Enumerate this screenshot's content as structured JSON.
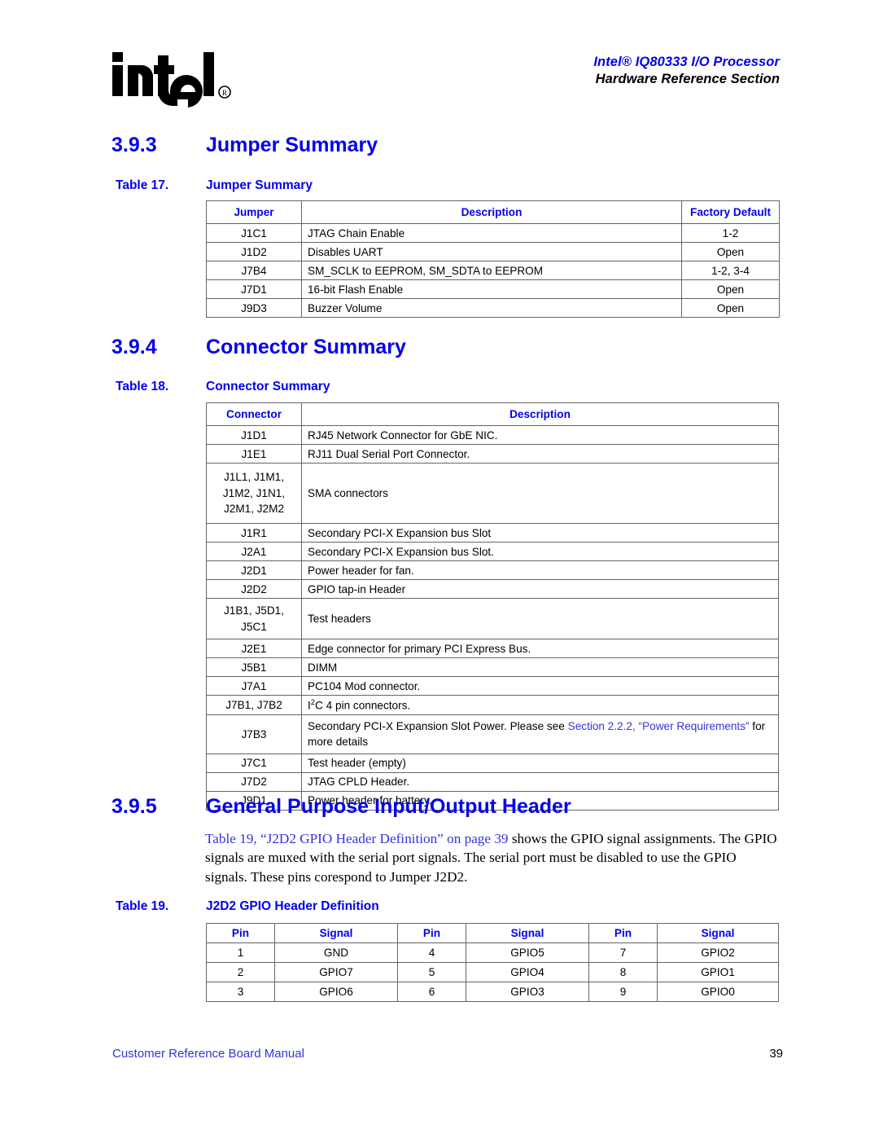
{
  "header": {
    "logo_alt": "intel",
    "title_line1": "Intel® IQ80333 I/O Processor",
    "title_line2": "Hardware Reference Section"
  },
  "sections": {
    "jumper": {
      "number": "3.9.3",
      "title": "Jumper Summary"
    },
    "connector": {
      "number": "3.9.4",
      "title": "Connector Summary"
    },
    "gpio": {
      "number": "3.9.5",
      "title": "General Purpose Input/Output Header"
    }
  },
  "table17": {
    "caption_number": "Table 17.",
    "caption_title": "Jumper Summary",
    "columns": [
      "Jumper",
      "Description",
      "Factory Default"
    ],
    "rows": [
      {
        "jumper": "J1C1",
        "description": "JTAG Chain Enable",
        "factory_default": "1-2"
      },
      {
        "jumper": "J1D2",
        "description": "Disables UART",
        "factory_default": "Open"
      },
      {
        "jumper": "J7B4",
        "description": "SM_SCLK to EEPROM, SM_SDTA to EEPROM",
        "factory_default": "1-2, 3-4"
      },
      {
        "jumper": "J7D1",
        "description": "16-bit Flash Enable",
        "factory_default": "Open"
      },
      {
        "jumper": "J9D3",
        "description": "Buzzer Volume",
        "factory_default": "Open"
      }
    ]
  },
  "table18": {
    "caption_number": "Table 18.",
    "caption_title": "Connector Summary",
    "columns": [
      "Connector",
      "Description"
    ],
    "rows": [
      {
        "connector": "J1D1",
        "description": "RJ45 Network Connector for GbE NIC."
      },
      {
        "connector": "J1E1",
        "description": "RJ11 Dual Serial Port Connector."
      },
      {
        "connector": "J1L1, J1M1,\nJ1M2, J1N1,\nJ2M1, J2M2",
        "description": "SMA connectors"
      },
      {
        "connector": "J1R1",
        "description": "Secondary PCI-X Expansion bus Slot"
      },
      {
        "connector": "J2A1",
        "description": "Secondary PCI-X Expansion bus Slot."
      },
      {
        "connector": "J2D1",
        "description": "Power header for fan."
      },
      {
        "connector": "J2D2",
        "description": "GPIO tap-in Header"
      },
      {
        "connector": "J1B1, J5D1,\nJ5C1",
        "description": "Test headers"
      },
      {
        "connector": "J2E1",
        "description": "Edge connector for primary PCI Express Bus."
      },
      {
        "connector": "J5B1",
        "description": "DIMM"
      },
      {
        "connector": "J7A1",
        "description": "PC104 Mod connector."
      },
      {
        "connector": "J7B1, J7B2",
        "description_prefix": "I",
        "description_superscript": "2",
        "description_suffix": "C 4 pin connectors."
      },
      {
        "connector": "J7B3",
        "description_pre_link": "Secondary PCI-X Expansion Slot Power. Please see ",
        "description_link": "Section 2.2.2, “Power Requirements”",
        "description_post_link": " for more details"
      },
      {
        "connector": "J7C1",
        "description": "Test header (empty)"
      },
      {
        "connector": "J7D2",
        "description": "JTAG CPLD Header."
      },
      {
        "connector": "J9D1",
        "description": "Power header for battery."
      }
    ]
  },
  "paragraph": {
    "link_text": "Table 19, “J2D2 GPIO Header Definition” on page 39",
    "rest_text": " shows the GPIO signal assignments. The GPIO signals are muxed with the serial port signals. The serial port must be disabled to use the GPIO signals. These pins corespond to Jumper J2D2."
  },
  "table19": {
    "caption_number": "Table 19.",
    "caption_title": "J2D2 GPIO Header Definition",
    "columns": [
      "Pin",
      "Signal",
      "Pin",
      "Signal",
      "Pin",
      "Signal"
    ],
    "rows": [
      [
        "1",
        "GND",
        "4",
        "GPIO5",
        "7",
        "GPIO2"
      ],
      [
        "2",
        "GPIO7",
        "5",
        "GPIO4",
        "8",
        "GPIO1"
      ],
      [
        "3",
        "GPIO6",
        "6",
        "GPIO3",
        "9",
        "GPIO0"
      ]
    ]
  },
  "footer": {
    "left": "Customer Reference Board Manual",
    "page_number": "39"
  },
  "colors": {
    "heading_blue": "#0000ee",
    "link_blue": "#3333dd",
    "border_gray": "#646464",
    "text_black": "#000000"
  }
}
